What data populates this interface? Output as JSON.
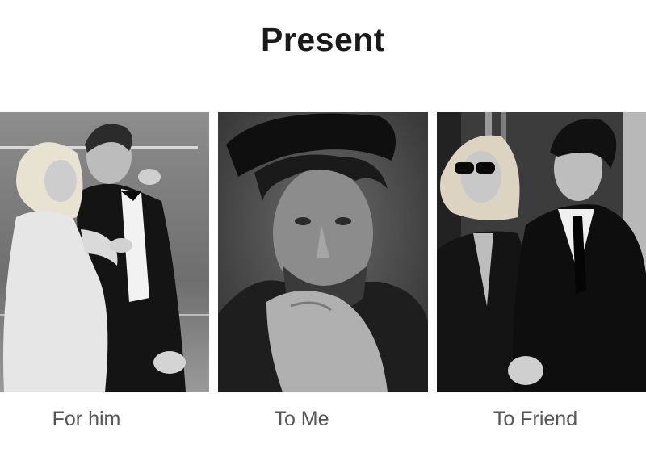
{
  "heading": "Present",
  "items": [
    {
      "label": "For him",
      "image": "couple-tuxedo-photo"
    },
    {
      "label": "To Me",
      "image": "man-portrait-photo"
    },
    {
      "label": "To Friend",
      "image": "couple-sunglasses-photo"
    }
  ],
  "colors": {
    "title": "#1a1a1a",
    "caption": "#555555",
    "background": "#ffffff"
  }
}
